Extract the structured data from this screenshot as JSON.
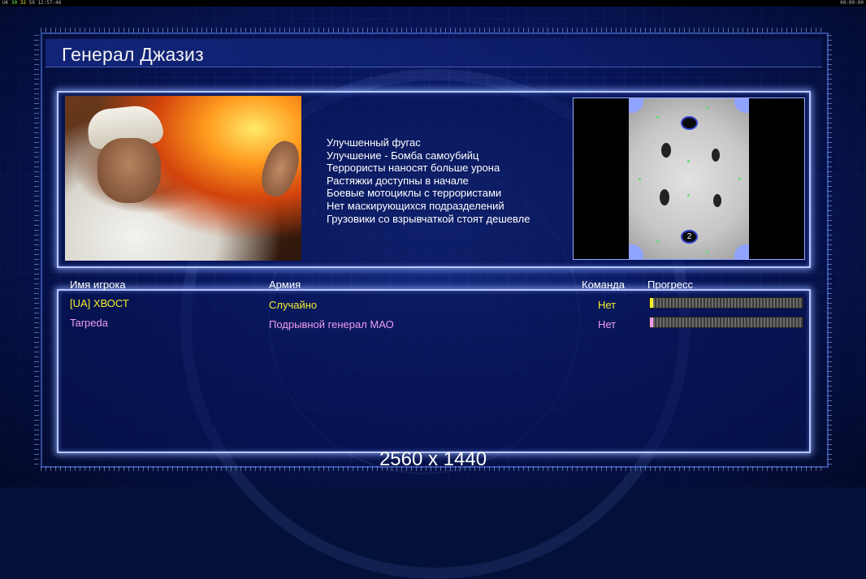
{
  "topbar": {
    "left_a": "UK",
    "left_b": "30",
    "left_c": "32",
    "left_d": "59",
    "left_time": "12:57:46",
    "right_time": "00:00:00"
  },
  "title": "Генерал Джазиз",
  "description": [
    "Улучшенный фугас",
    "Улучшение - Бомба самоубийц",
    "Террористы наносят больше урона",
    "Растяжки доступны в начале",
    "Боевые мотоциклы с террористами",
    "Нет маскирующихся подразделений",
    "Грузовики со взрывчаткой стоят дешевле"
  ],
  "map": {
    "spawn_2": "2"
  },
  "table": {
    "headers": {
      "name": "Имя игрока",
      "army": "Армия",
      "team": "Команда",
      "progress": "Прогресс"
    },
    "rows": [
      {
        "name": "[UA] ХВОСТ",
        "army": "Случайно",
        "team": "Нет",
        "progress": 0.02,
        "color": "#f5f02b"
      },
      {
        "name": "Tarpeda",
        "army": "Подрывной генерал МАО",
        "team": "Нет",
        "progress": 0.02,
        "color": "#ef9cf2"
      }
    ]
  },
  "resolution": "2560 x 1440"
}
